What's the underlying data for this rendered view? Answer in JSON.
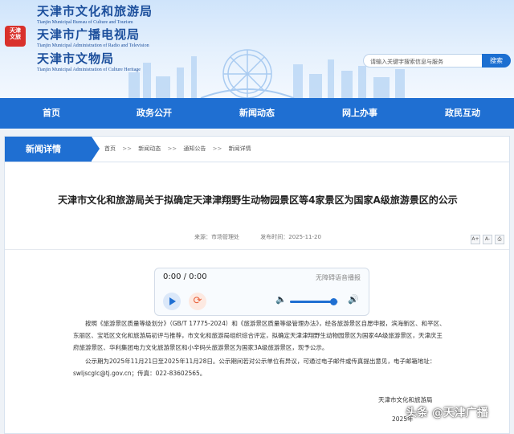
{
  "header": {
    "logo_text": "天津文旅",
    "orgs": [
      {
        "cn": "天津市文化和旅游局",
        "en": "Tianjin Municipal Bureau of Culture and Tourism"
      },
      {
        "cn": "天津市广播电视局",
        "en": "Tianjin Municipal Administration of Radio and Television"
      },
      {
        "cn": "天津市文物局",
        "en": "Tianjin Municipal Administration of Culture Heritage"
      }
    ],
    "search": {
      "placeholder": "请输入关键字搜索信息与服务",
      "button": "搜索"
    }
  },
  "nav": {
    "items": [
      "首页",
      "政务公开",
      "新闻动态",
      "网上办事",
      "政民互动"
    ]
  },
  "breadcrumb": {
    "section_title": "新闻详情",
    "items": [
      "首页",
      "新闻动态",
      "通知公告",
      "新闻详情"
    ],
    "separator": ">>"
  },
  "article": {
    "title": "天津市文化和旅游局关于拟确定天津津翔野生动物园景区等4家景区为国家A级旅游景区的公示",
    "source": "来源：市场管理处",
    "date": "发布时间：2025-11-20",
    "tools": [
      "A+",
      "A-",
      "⎙"
    ],
    "player": {
      "time": "0:00 / 0:00",
      "label": "无障碍语音播报",
      "volume": 0.9
    },
    "paragraphs": [
      "按照《旅游景区质量等级划分》（GB/T 17775-2024）和《旅游景区质量等级管理办法》，经各旅游景区自愿申报，滨海新区、和平区、东丽区、宝坻区文化和旅游局初评与推荐，市文化和旅游局组织综合评定，拟确定天津津翔野生动物园景区为国家4A级旅游景区，天津庆王府旅游景区、华利集团电力文化旅游景区和小辛码头旅游景区为国家3A级旅游景区，现予公示。",
      "公示期为2025年11月21日至2025年11月28日。公示期间若对公示单位有异议，可通过电子邮件或传真提出意见，电子邮箱地址：swljscglc@tj.gov.cn；传真：022-83602565。"
    ],
    "signature": "天津市文化和旅游局",
    "sign_date": "2025年"
  },
  "watermark": "头条 @天津广播"
}
